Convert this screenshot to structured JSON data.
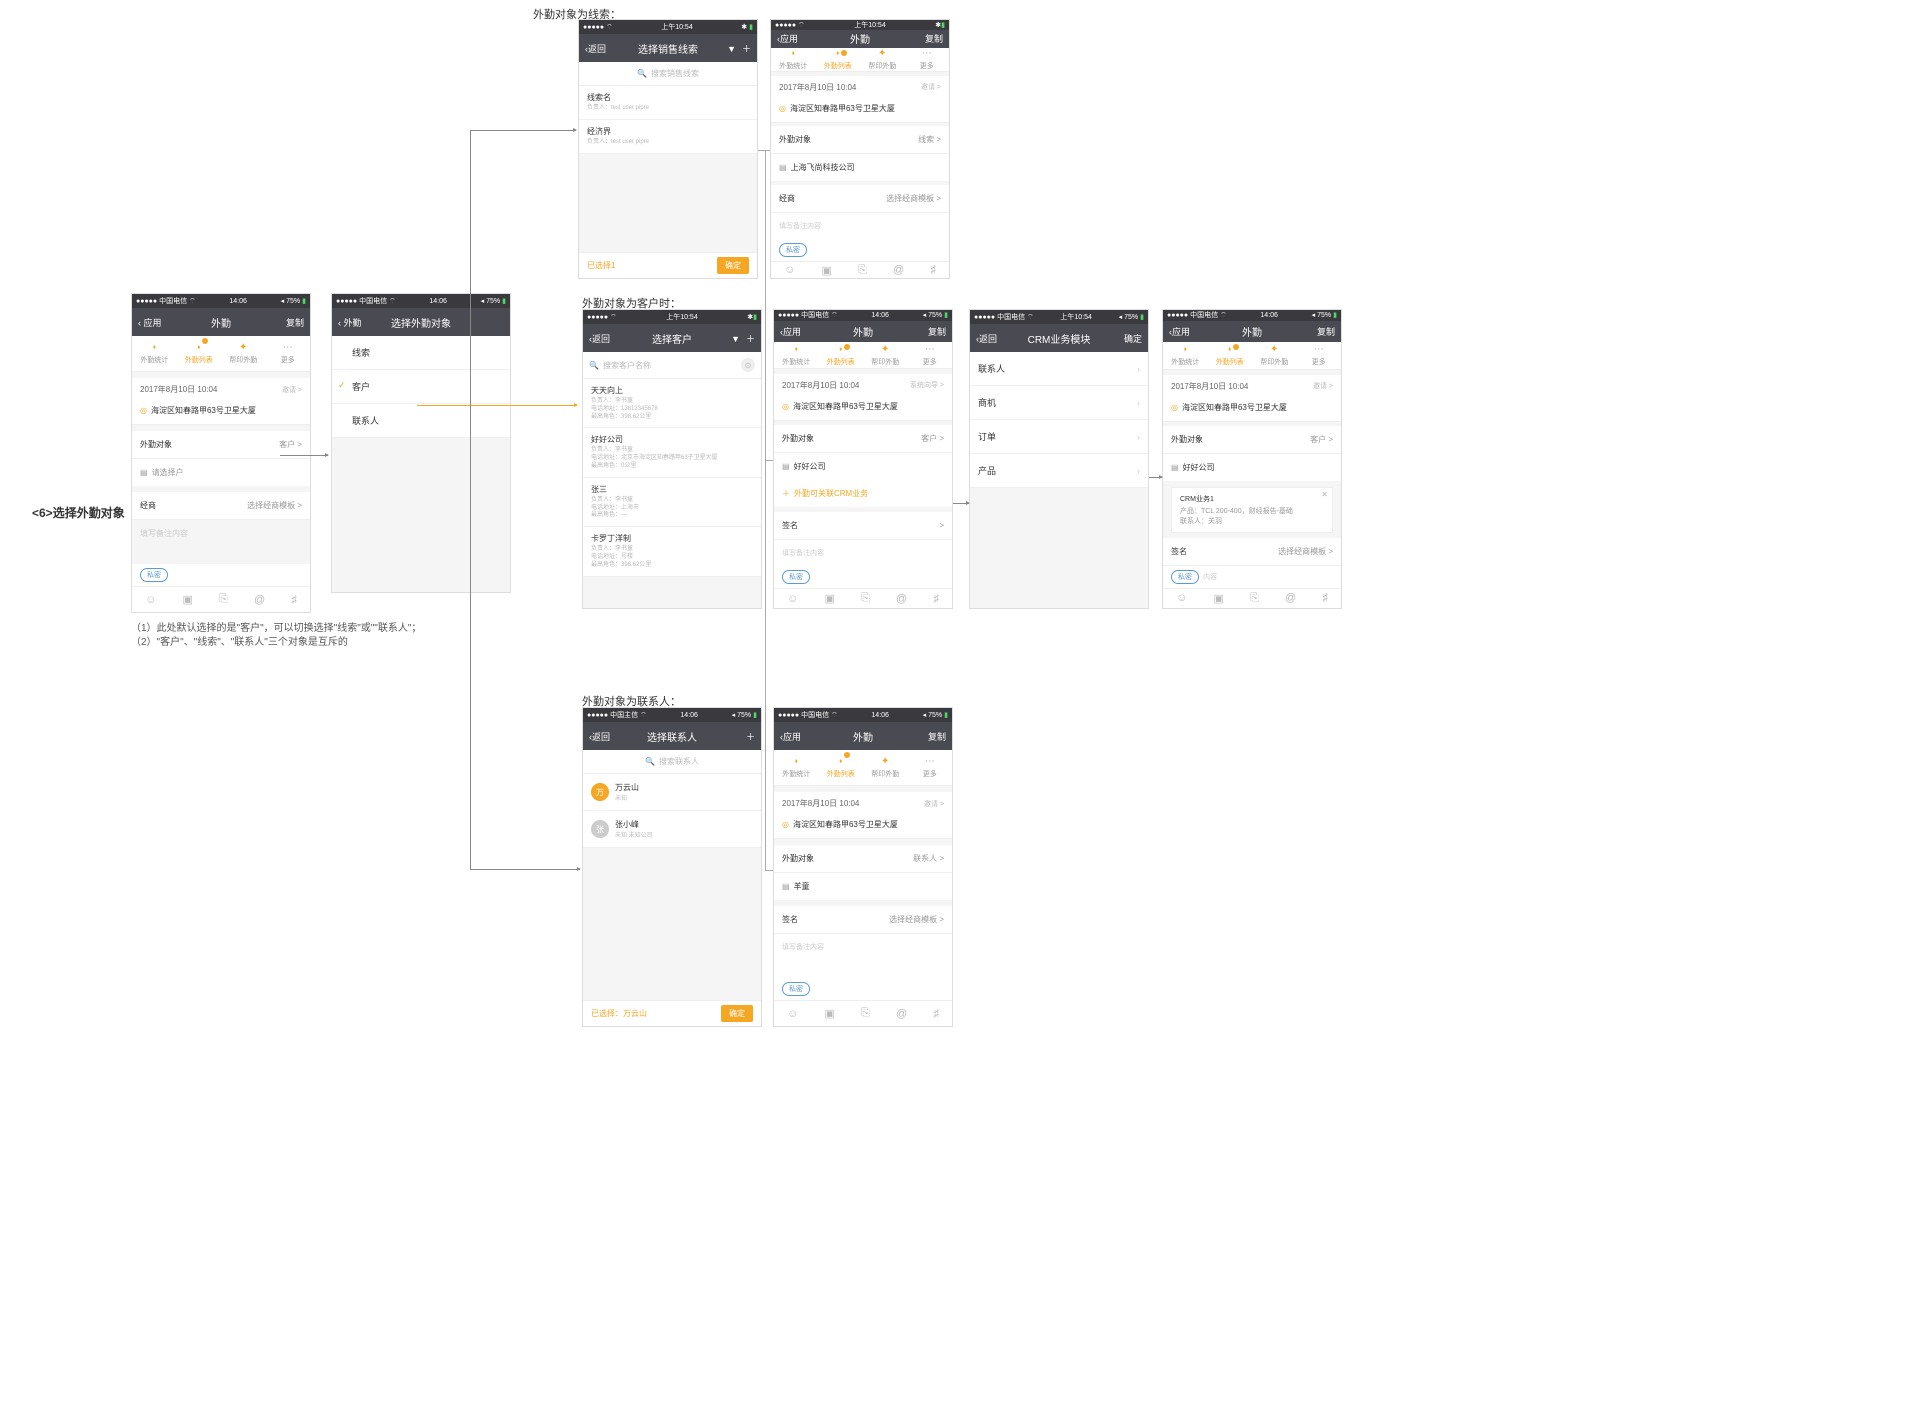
{
  "labels": {
    "section_title": "<6>选择外勤对象",
    "note_line1": "（1）此处默认选择的是\"客户\"，可以切换选择\"线索\"或\"\"联系人\"；",
    "note_line2": "（2）\"客户\"、\"线索\"、\"联系人\"三个对象是互斥的",
    "heading_lead": "外勤对象为线索：",
    "heading_cust": "外勤对象为客户时：",
    "heading_contact": "外勤对象为联系人："
  },
  "common": {
    "carrier": "中国电信",
    "time_1406": "14:06",
    "time_1054": "上午10:54",
    "battery": "75%",
    "back": "应用",
    "back_return": "返回",
    "title_field": "外勤",
    "copy": "复制",
    "tabs": [
      "外勤统计",
      "外勤列表",
      "帮印外勤",
      "更多"
    ],
    "dt_text": "2017年8月10日 10:04",
    "addr": "海淀区知春路甲63号卫星大厦",
    "obj_label": "外勤对象",
    "placeholder_cust": "请选择户",
    "invite": "邀请 >",
    "remark_label": "经商",
    "remark_right": "选择经商模板 >",
    "content_ph": "填写备注内容",
    "pill_text": "私密",
    "confirm": "确定",
    "selected": "已选择：",
    "company_b": "好好公司",
    "company_a": "上海飞尚科技公司",
    "crm_plus": "外勤可关联CRM业务",
    "signature": "签名",
    "type_cust": "客户 >",
    "type_lead": "线索 >",
    "type_contact": "联系人 >",
    "system_right": "系统向导 >"
  },
  "p2": {
    "title": "选择外勤对象",
    "opt1": "线索",
    "opt2": "客户",
    "opt3": "联系人"
  },
  "p3": {
    "title": "选择销售线索",
    "search_ph": "搜索销售线索",
    "item1_t": "线索名",
    "item1_s": "负责人：test user pipre",
    "item2_t": "经济界",
    "item2_s": "负责人：test user pipre",
    "selected_txt": "已选择1"
  },
  "p5": {
    "title": "选择客户",
    "search_ph": "搜索客户名称",
    "c1_t": "天天向上",
    "c1_s1": "负责人：李书童",
    "c1_s2": "电话地址：13812345678",
    "c1_s3": "最高角色：398.62公里",
    "c2_t": "好好公司",
    "c2_s1": "负责人：李书童",
    "c2_s2": "电话地址：北京市海淀区知春路甲63子卫星大厦",
    "c2_s3": "最高角色：0公里",
    "c3_t": "张三",
    "c3_s1": "负责人：李书童",
    "c3_s2": "电话地址：上海市",
    "c3_s3": "最高角色：—",
    "c4_t": "卡罗丁洋制",
    "c4_s1": "负责人：李书童",
    "c4_s2": "电话地址：号楼",
    "c4_s3": "最高角色：398.62公里"
  },
  "p7": {
    "title": "CRM业务模块",
    "done": "确定",
    "m1": "联系人",
    "m2": "商机",
    "m3": "订单",
    "m4": "产品"
  },
  "p8": {
    "card_h": "CRM业务1",
    "card_r1": "产品：TCL 200-400，财经报告-基础",
    "card_r2": "联系人：关羽"
  },
  "p9": {
    "title": "选择联系人",
    "search_ph": "搜索联系人",
    "c1_n": "万云山",
    "c1_s": "未知",
    "c2_n": "张小峰",
    "c2_s": "未知 未知公司",
    "sel": "万云山"
  },
  "p10": {
    "contact_name": "羊童"
  }
}
